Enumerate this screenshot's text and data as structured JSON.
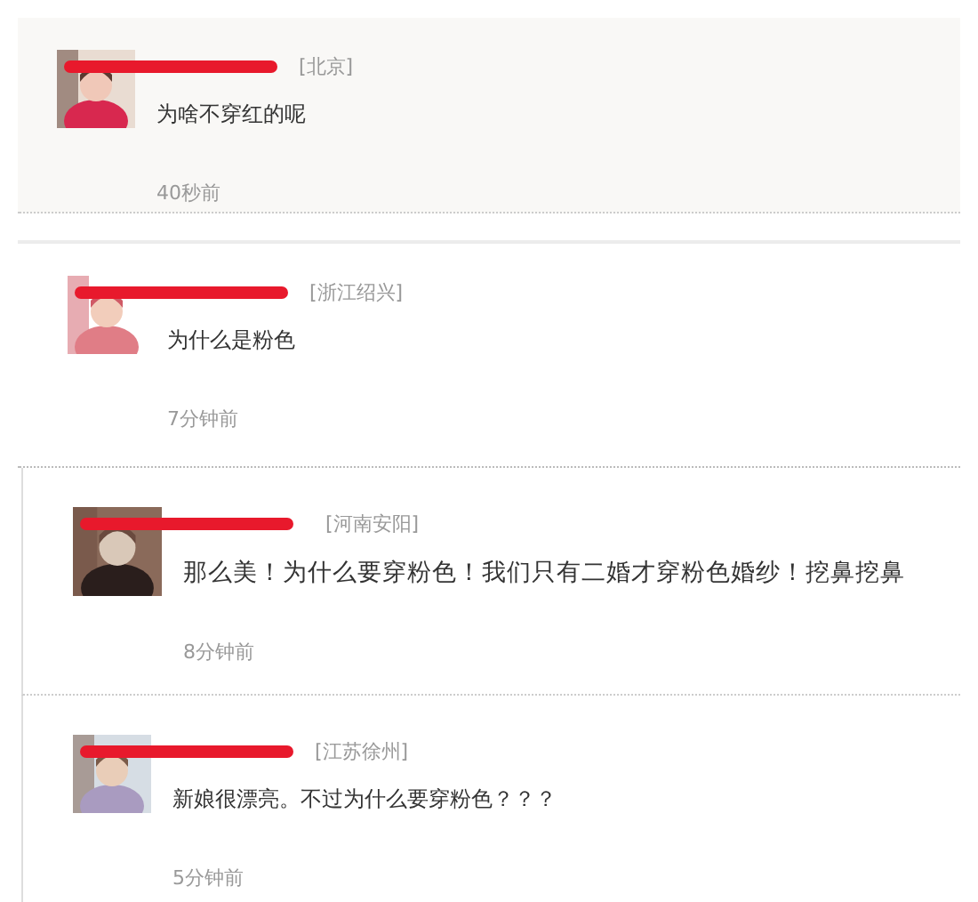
{
  "comments": [
    {
      "kind": "highlighted",
      "location": "[北京]",
      "text": "为啥不穿红的呢",
      "time": "40秒前"
    },
    {
      "kind": "plain",
      "location": "[浙江绍兴]",
      "text": "为什么是粉色",
      "time": "7分钟前"
    },
    {
      "kind": "indented",
      "location": "[河南安阳]",
      "text": "那么美！为什么要穿粉色！我们只有二婚才穿粉色婚纱！挖鼻挖鼻",
      "time": "8分钟前"
    },
    {
      "kind": "indented",
      "location": "[江苏徐州]",
      "text": "新娘很漂亮。不过为什么要穿粉色？？？",
      "time": "5分钟前"
    }
  ]
}
